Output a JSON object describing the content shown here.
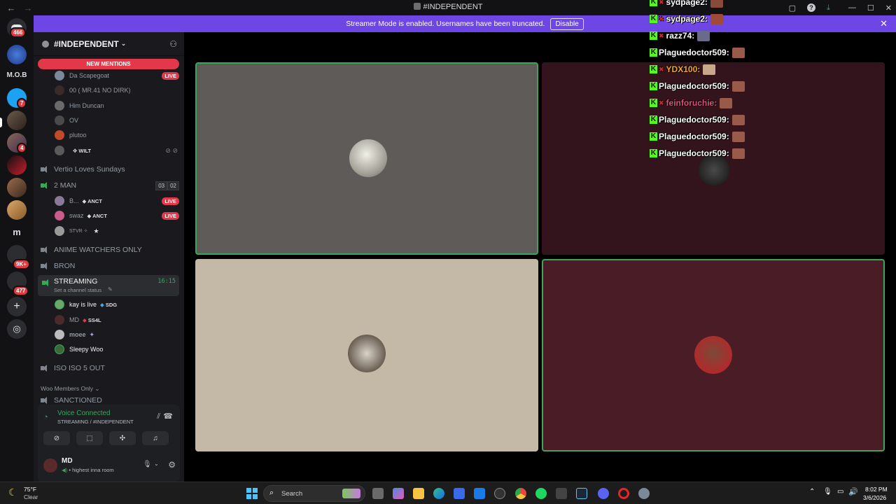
{
  "window": {
    "title": "#INDEPENDENT"
  },
  "banner": {
    "text": "Streamer Mode is enabled. Usernames have been truncated.",
    "button": "Disable"
  },
  "rail": {
    "badges": [
      "466",
      "7",
      "4",
      "9K+",
      "477"
    ],
    "mob_label": "M.O.B",
    "m_label": "m"
  },
  "sidebar": {
    "guild_name": "#INDEPENDENT",
    "new_mentions": "NEW MENTIONS",
    "users_top": [
      {
        "name": "Da Scapegoat",
        "live": "LIVE"
      },
      {
        "name": "00 ( MR.41 NO DIRK)"
      },
      {
        "name": "Him Duncan"
      },
      {
        "name": "OV"
      },
      {
        "name": "plutoo"
      },
      {
        "name": "",
        "tag": "WILT"
      }
    ],
    "channels": [
      {
        "name": "Vertio Loves Sundays"
      },
      {
        "name": "2 MAN",
        "counts": [
          "03",
          "02"
        ]
      }
    ],
    "users_2man": [
      {
        "name": "B...",
        "tag": "ANCT",
        "live": "LIVE"
      },
      {
        "name": "swaz",
        "tag": "ANCT",
        "live": "LIVE"
      },
      {
        "name": "STVR ✧",
        "tag": ""
      }
    ],
    "channels2": [
      {
        "name": "ANIME WATCHERS ONLY"
      },
      {
        "name": "BRON"
      }
    ],
    "streaming": {
      "name": "STREAMING",
      "time": "16:15",
      "status": "Set a channel status"
    },
    "users_streaming": [
      {
        "name": "kay is live",
        "tag": "SDG"
      },
      {
        "name": "MD",
        "tag": "SS4L"
      },
      {
        "name": "moee",
        "tag": ""
      },
      {
        "name": "Sleepy Woo",
        "tag": ""
      }
    ],
    "channels3": [
      {
        "name": "ISO ISO 5 OUT"
      }
    ],
    "category": "Woo Members Only",
    "partial_channel": "SANCTIONED"
  },
  "voice_panel": {
    "status": "Voice Connected",
    "location": "STREAMING / #INDEPENDENT",
    "username": "MD",
    "user_status": "highest inna room"
  },
  "chat": [
    {
      "name": "sydpage2:",
      "color": "#ffffff"
    },
    {
      "name": "sydpage2:",
      "color": "#ffffff"
    },
    {
      "name": "razz74:",
      "color": "#ffffff"
    },
    {
      "name": "Plaguedoctor509:",
      "color": "#ffffff"
    },
    {
      "name": "YDX100:",
      "color": "#f5a623"
    },
    {
      "name": "Plaguedoctor509:",
      "color": "#ffffff"
    },
    {
      "name": "feinforuchie:",
      "color": "#e0507a"
    },
    {
      "name": "Plaguedoctor509:",
      "color": "#ffffff"
    },
    {
      "name": "Plaguedoctor509:",
      "color": "#ffffff"
    },
    {
      "name": "Plaguedoctor509:",
      "color": "#ffffff"
    }
  ],
  "taskbar": {
    "weather_temp": "75°F",
    "weather_desc": "Clear",
    "search_placeholder": "Search",
    "time": "8:02 PM",
    "date": "3/6/2026"
  },
  "colors": {
    "accent": "#6f46e6",
    "live_red": "#e3384a",
    "voice_green": "#3ba55c",
    "kick_green": "#53fc18"
  }
}
